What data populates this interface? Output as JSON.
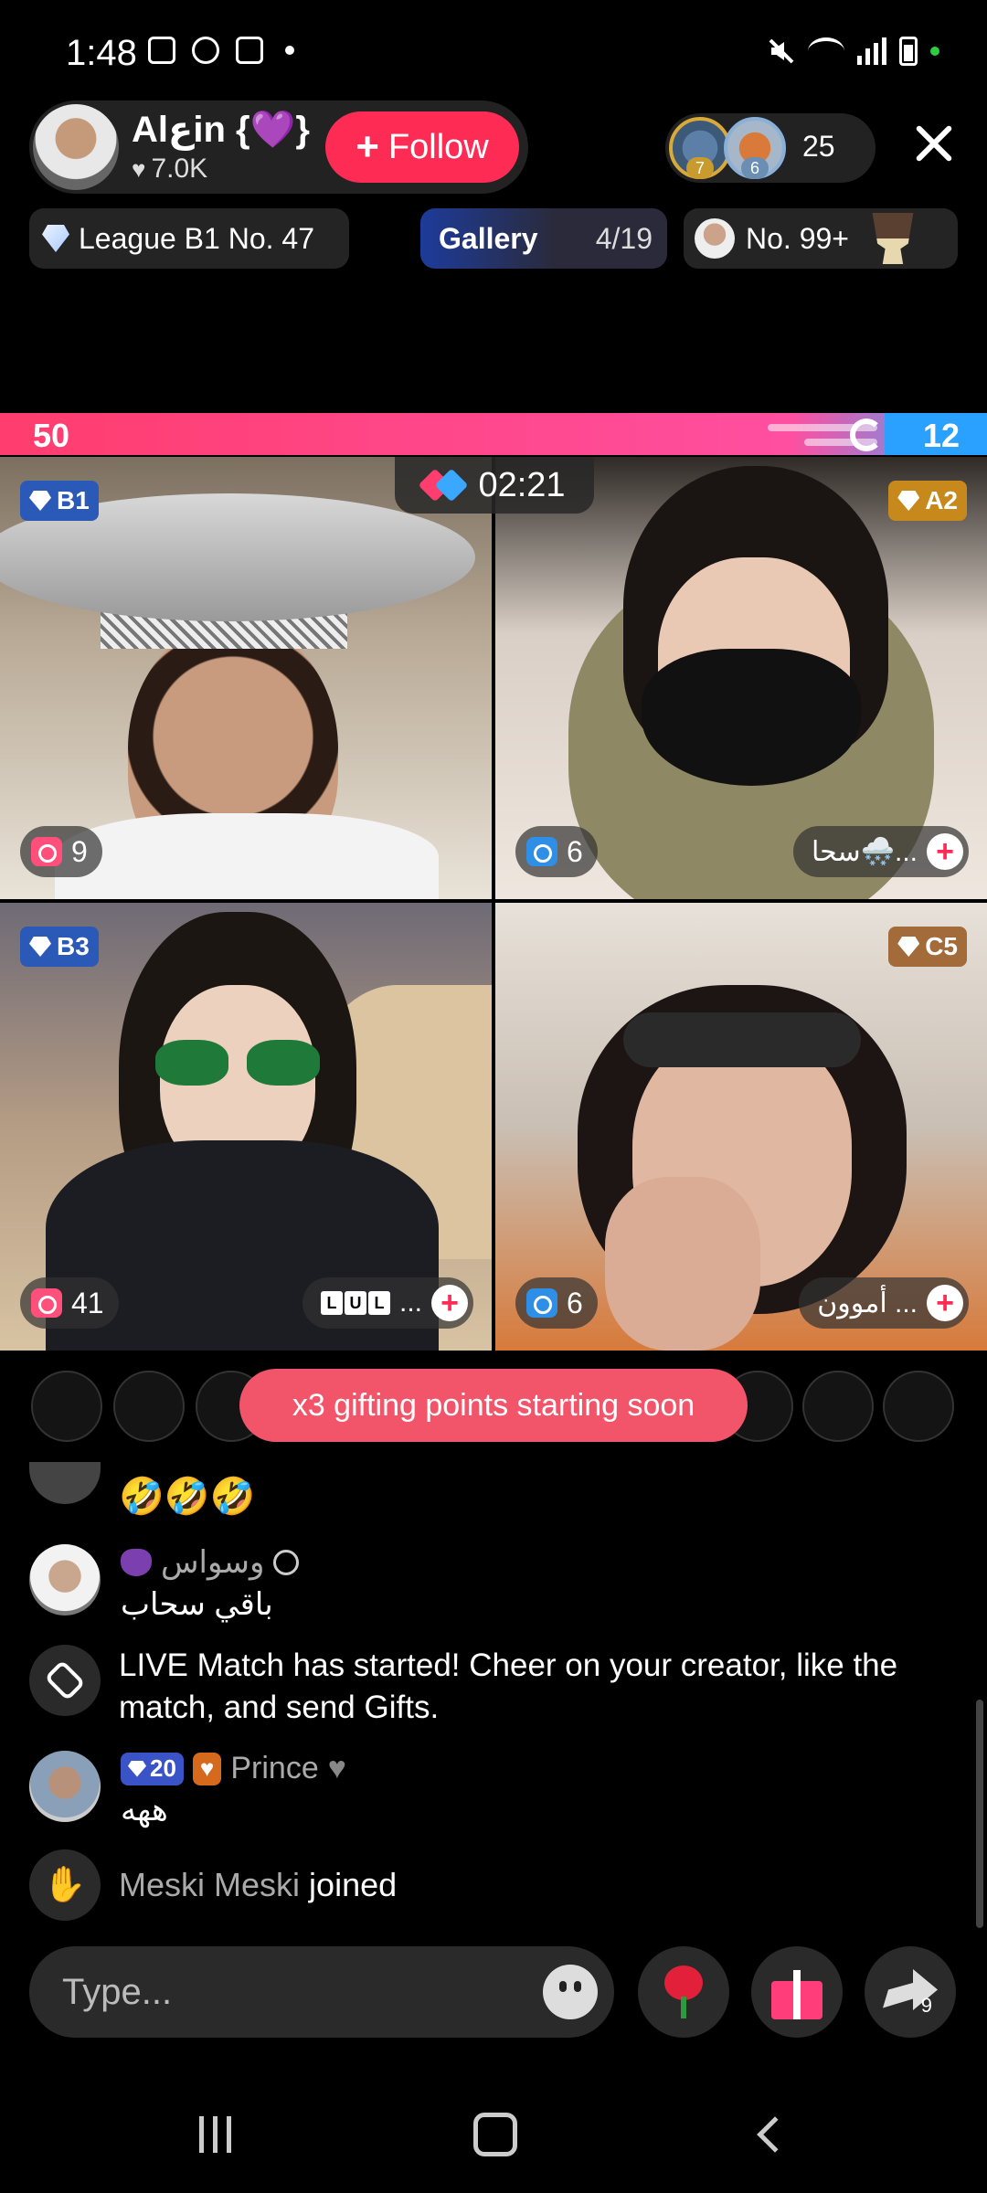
{
  "status": {
    "time": "1:48"
  },
  "host": {
    "name": "Alعin {💜}",
    "likes": "7.0K",
    "follow_label": "Follow"
  },
  "viewers": {
    "avatar1_rank": "7",
    "avatar2_rank": "6",
    "count": "25"
  },
  "chips": {
    "league": "League B1 No. 47",
    "gallery_label": "Gallery",
    "gallery_count": "4/19",
    "rank": "No. 99+"
  },
  "match": {
    "score_left": "50",
    "score_right": "12",
    "timer": "02:21",
    "colors": {
      "left": "#ff3d6e",
      "right": "#2aa0ff"
    }
  },
  "tiles": [
    {
      "tier": "B1",
      "likes": "9",
      "name": ""
    },
    {
      "tier": "A2",
      "likes": "6",
      "name": "سحا🌨️..."
    },
    {
      "tier": "B3",
      "likes": "41",
      "name": "...",
      "name_boxes": [
        "L",
        "U",
        "L"
      ]
    },
    {
      "tier": "C5",
      "likes": "6",
      "name": "أموون ..."
    }
  ],
  "banner": {
    "text": "x3 gifting points starting soon"
  },
  "chat": {
    "emoji_line": "🤣🤣🤣",
    "msg1_user": "وسواس",
    "msg1_text": "باقي سحاب",
    "system_text": "LIVE Match has started! Cheer on your creator, like the match, and send Gifts.",
    "msg2_level": "20",
    "msg2_user": "Prince",
    "msg2_text": "ههه",
    "join_name": "Meski Meski",
    "join_suffix": "joined"
  },
  "input": {
    "placeholder": "Type...",
    "share_count": "9"
  }
}
